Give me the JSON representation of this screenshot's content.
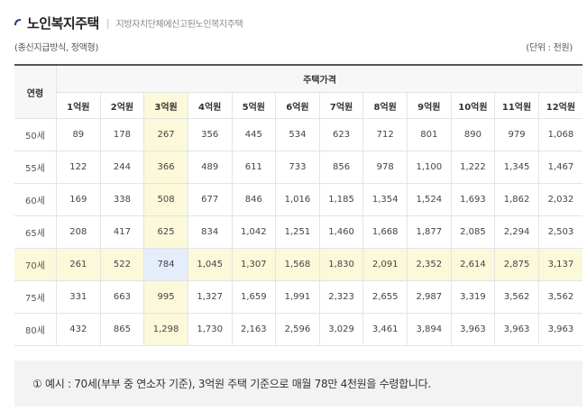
{
  "header": {
    "title": "노인복지주택",
    "separator": "|",
    "breadcrumb": "지방자치단체에신고된노인복지주택"
  },
  "meta": {
    "type_label": "(종신지급방식, 정액형)",
    "unit_label": "(단위 : 천원)"
  },
  "colors": {
    "highlight": "#fbf9d9",
    "cross_highlight": "#e5ecfa",
    "accent": "#2a3d7a"
  },
  "table": {
    "age_header": "연령",
    "group_header": "주택가격",
    "price_headers": [
      "1억원",
      "2억원",
      "3억원",
      "4억원",
      "5억원",
      "6억원",
      "7억원",
      "8억원",
      "9억원",
      "10억원",
      "11억원",
      "12억원"
    ],
    "highlight_column": 2,
    "highlight_row": 4,
    "rows": [
      {
        "age": "50세",
        "values": [
          "89",
          "178",
          "267",
          "356",
          "445",
          "534",
          "623",
          "712",
          "801",
          "890",
          "979",
          "1,068"
        ]
      },
      {
        "age": "55세",
        "values": [
          "122",
          "244",
          "366",
          "489",
          "611",
          "733",
          "856",
          "978",
          "1,100",
          "1,222",
          "1,345",
          "1,467"
        ]
      },
      {
        "age": "60세",
        "values": [
          "169",
          "338",
          "508",
          "677",
          "846",
          "1,016",
          "1,185",
          "1,354",
          "1,524",
          "1,693",
          "1,862",
          "2,032"
        ]
      },
      {
        "age": "65세",
        "values": [
          "208",
          "417",
          "625",
          "834",
          "1,042",
          "1,251",
          "1,460",
          "1,668",
          "1,877",
          "2,085",
          "2,294",
          "2,503"
        ]
      },
      {
        "age": "70세",
        "values": [
          "261",
          "522",
          "784",
          "1,045",
          "1,307",
          "1,568",
          "1,830",
          "2,091",
          "2,352",
          "2,614",
          "2,875",
          "3,137"
        ]
      },
      {
        "age": "75세",
        "values": [
          "331",
          "663",
          "995",
          "1,327",
          "1,659",
          "1,991",
          "2,323",
          "2,655",
          "2,987",
          "3,319",
          "3,562",
          "3,562"
        ]
      },
      {
        "age": "80세",
        "values": [
          "432",
          "865",
          "1,298",
          "1,730",
          "2,163",
          "2,596",
          "3,029",
          "3,461",
          "3,894",
          "3,963",
          "3,963",
          "3,963"
        ]
      }
    ]
  },
  "note": {
    "text": "① 예시 : 70세(부부 중 연소자 기준), 3억원 주택 기준으로 매월 78만 4천원을 수령합니다."
  }
}
